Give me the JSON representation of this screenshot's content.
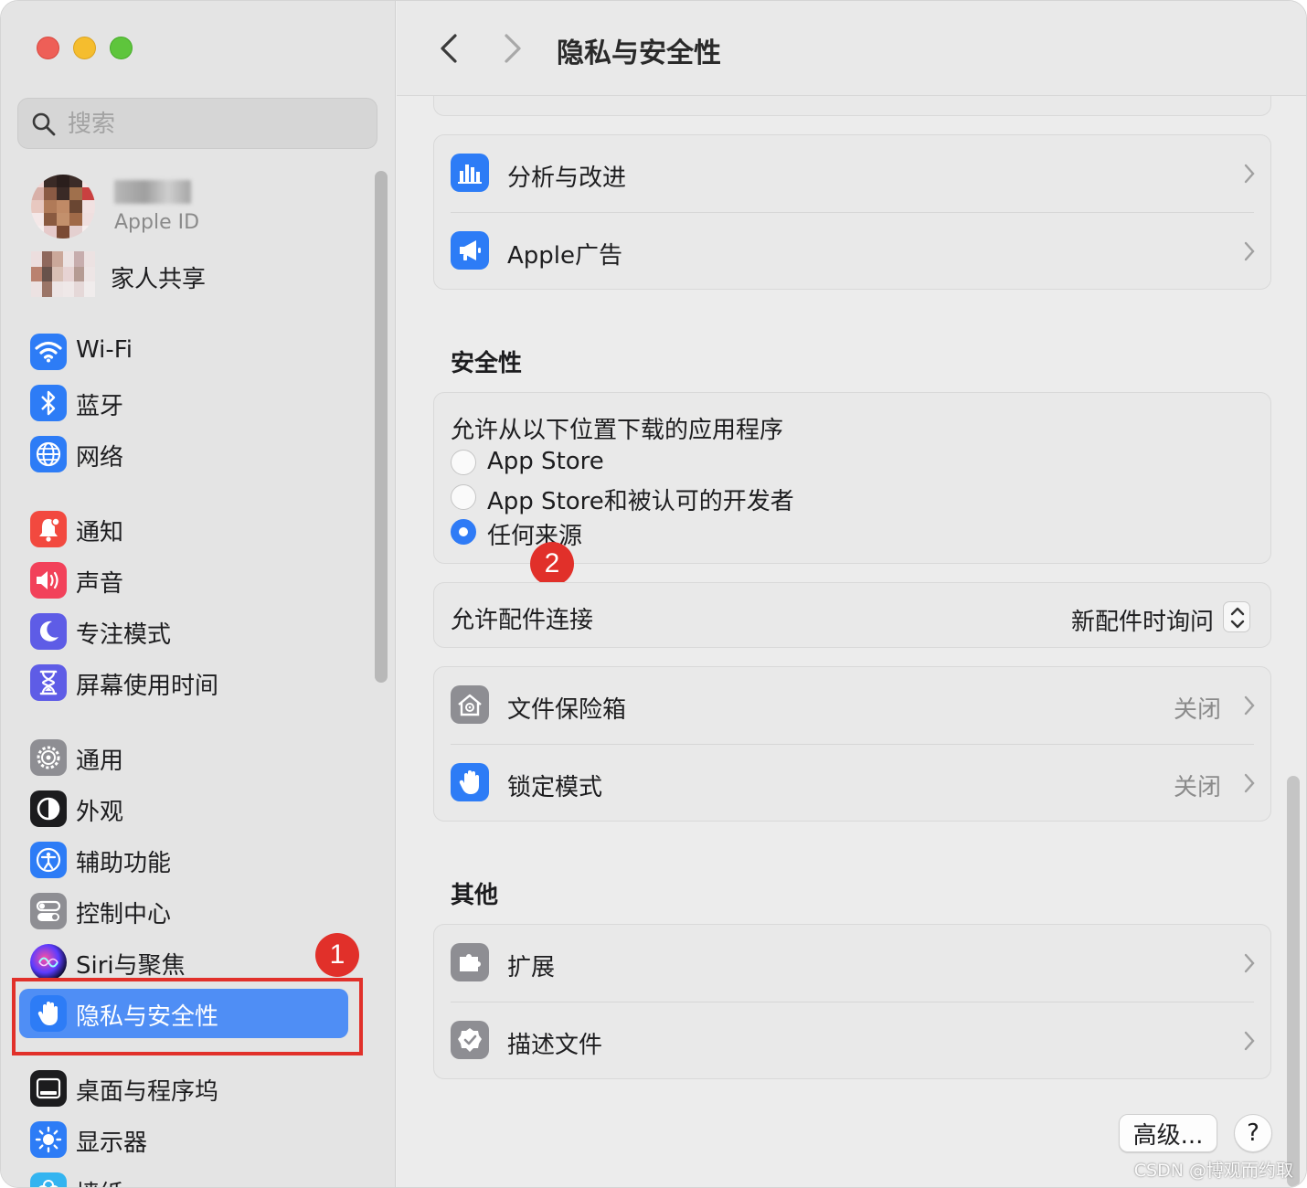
{
  "window": {
    "title": "隐私与安全性",
    "nav_back": "back",
    "nav_forward": "forward"
  },
  "sidebar": {
    "search_placeholder": "搜索",
    "account": {
      "subtitle": "Apple ID",
      "family_label": "家人共享"
    },
    "items": [
      {
        "label": "Wi-Fi",
        "icon": "wifi-icon",
        "color": "#2d7cf6"
      },
      {
        "label": "蓝牙",
        "icon": "bluetooth-icon",
        "color": "#2d7cf6"
      },
      {
        "label": "网络",
        "icon": "globe-icon",
        "color": "#2d7cf6"
      },
      {
        "label": "通知",
        "icon": "bell-icon",
        "color": "#f2493f"
      },
      {
        "label": "声音",
        "icon": "speaker-icon",
        "color": "#f2415a"
      },
      {
        "label": "专注模式",
        "icon": "moon-icon",
        "color": "#5e5ce6"
      },
      {
        "label": "屏幕使用时间",
        "icon": "hourglass-icon",
        "color": "#5e5ce6"
      },
      {
        "label": "通用",
        "icon": "gear-icon",
        "color": "#8e8e93"
      },
      {
        "label": "外观",
        "icon": "appearance-icon",
        "color": "#1c1c1e"
      },
      {
        "label": "辅助功能",
        "icon": "accessibility-icon",
        "color": "#2d7cf6"
      },
      {
        "label": "控制中心",
        "icon": "toggles-icon",
        "color": "#8e8e93"
      },
      {
        "label": "Siri与聚焦",
        "icon": "siri-icon",
        "color": "#3a3a6a"
      },
      {
        "label": "隐私与安全性",
        "icon": "hand-icon",
        "color": "#2d7cf6",
        "selected": true
      },
      {
        "label": "桌面与程序坞",
        "icon": "dock-icon",
        "color": "#1c1c1e"
      },
      {
        "label": "显示器",
        "icon": "sun-icon",
        "color": "#2d7cf6"
      },
      {
        "label": "墙纸",
        "icon": "flower-icon",
        "color": "#33b4f0"
      }
    ]
  },
  "annotations": {
    "badge1": "1",
    "badge2": "2",
    "highlight_color": "#e1302a"
  },
  "privacy": {
    "rows": [
      {
        "label": "分析与改进",
        "icon": "chart-icon",
        "color": "#2d7cf6"
      },
      {
        "label": "Apple广告",
        "icon": "megaphone-icon",
        "color": "#2d7cf6"
      }
    ]
  },
  "security": {
    "title": "安全性",
    "allow_apps_title": "允许从以下位置下载的应用程序",
    "options": [
      {
        "label": "App Store",
        "selected": false
      },
      {
        "label": "App Store和被认可的开发者",
        "selected": false
      },
      {
        "label": "任何来源",
        "selected": true
      }
    ],
    "accessory_label": "允许配件连接",
    "accessory_value": "新配件时询问",
    "filevault": {
      "label": "文件保险箱",
      "value": "关闭",
      "icon": "house-lock-icon",
      "color": "#8e8e93"
    },
    "lockdown": {
      "label": "锁定模式",
      "value": "关闭",
      "icon": "hand-icon",
      "color": "#2d7cf6"
    }
  },
  "other": {
    "title": "其他",
    "rows": [
      {
        "label": "扩展",
        "icon": "puzzle-icon",
        "color": "#8e8e93"
      },
      {
        "label": "描述文件",
        "icon": "checkmark-badge-icon",
        "color": "#8e8e93"
      }
    ]
  },
  "footer": {
    "advanced_label": "高级...",
    "help_label": "?"
  },
  "watermark": "CSDN @博观而约取"
}
